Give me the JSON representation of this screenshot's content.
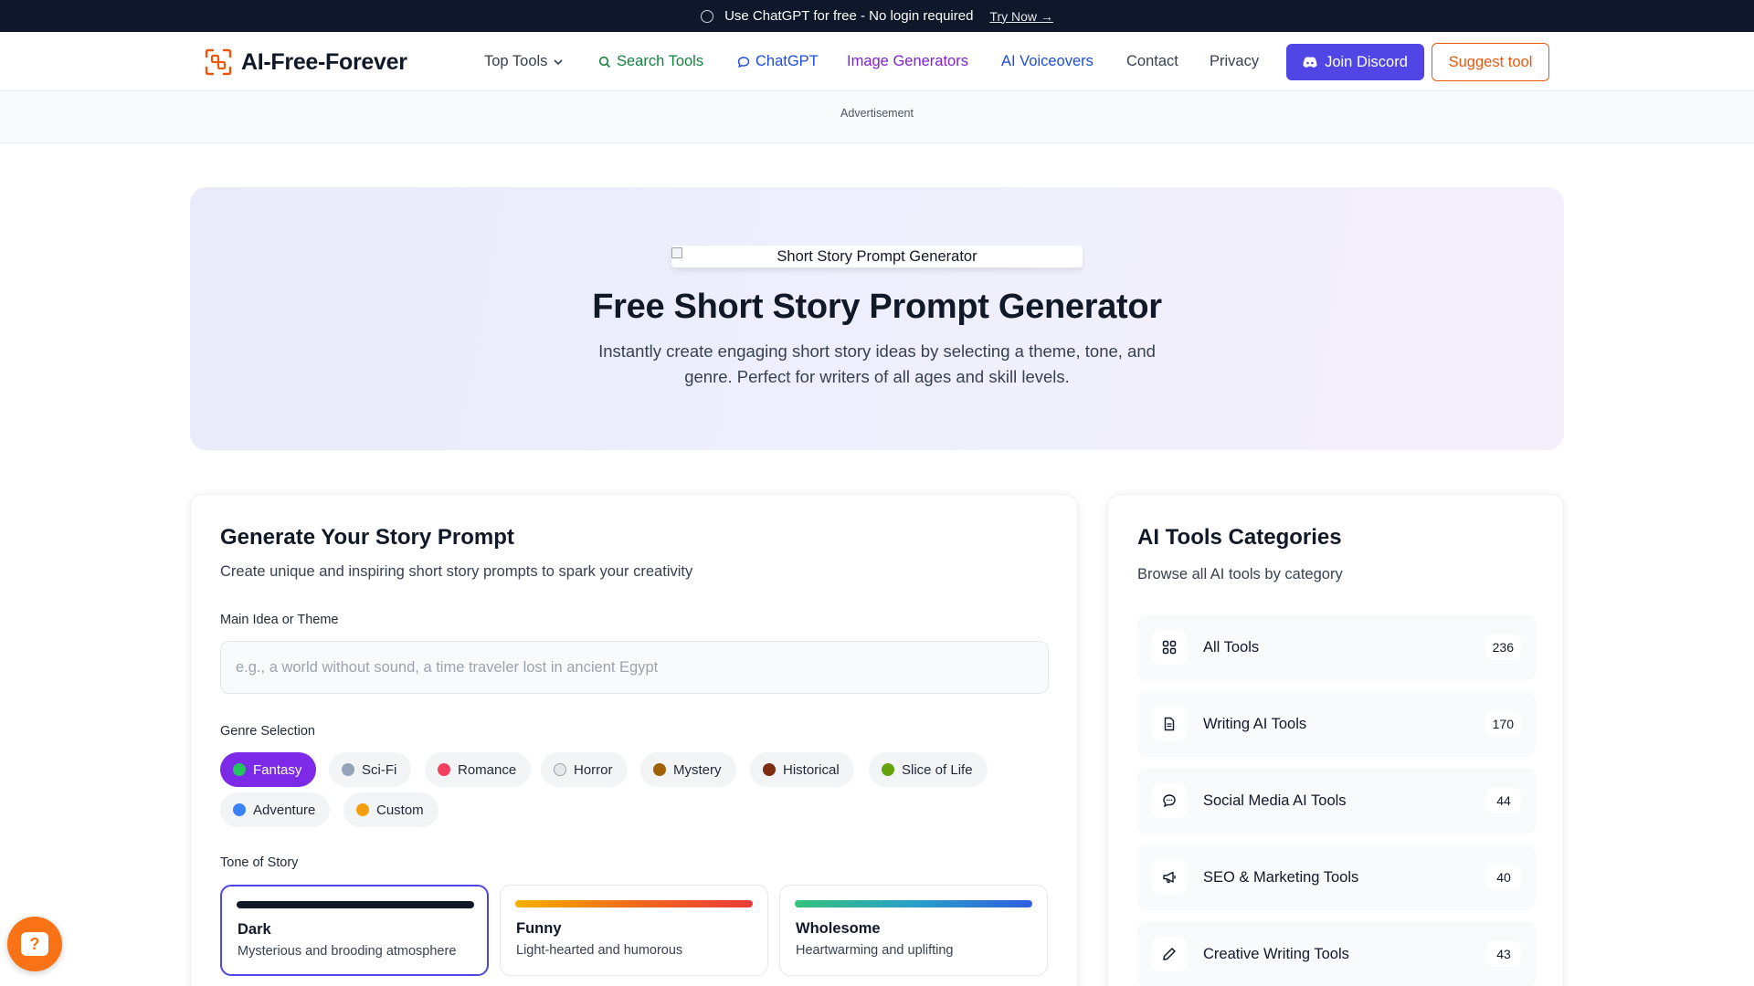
{
  "banner": {
    "text": "Use ChatGPT for free - No login required",
    "link": "Try Now →"
  },
  "nav": {
    "logo": "AI-Free-Forever",
    "links": [
      {
        "label": "Top Tools",
        "color": "#374151"
      },
      {
        "label": "Search Tools",
        "color": "#15803d"
      },
      {
        "label": "ChatGPT",
        "color": "#1d4ed8"
      },
      {
        "label": "Image Generators",
        "color": "#7e22ce"
      },
      {
        "label": "AI Voiceovers",
        "color": "#1d4ed8"
      },
      {
        "label": "Contact",
        "color": "#374151"
      },
      {
        "label": "Privacy",
        "color": "#374151"
      }
    ],
    "discord": "Join Discord",
    "suggest": "Suggest tool"
  },
  "ad": {
    "label": "Advertisement"
  },
  "hero": {
    "image_alt": "Short Story Prompt Generator",
    "title": "Free Short Story Prompt Generator",
    "subtitle": "Instantly create engaging short story ideas by selecting a theme, tone, and genre. Perfect for writers of all ages and skill levels."
  },
  "generator": {
    "title": "Generate Your Story Prompt",
    "subtitle": "Create unique and inspiring short story prompts to spark your creativity",
    "theme_label": "Main Idea or Theme",
    "theme_placeholder": "e.g., a world without sound, a time traveler lost in ancient Egypt",
    "theme_value": "",
    "genre_label": "Genre Selection",
    "genres": [
      {
        "label": "Fantasy",
        "icon": "dragon-icon",
        "active": true
      },
      {
        "label": "Sci-Fi",
        "icon": "rocket-icon",
        "active": false
      },
      {
        "label": "Romance",
        "icon": "heart-icon",
        "active": false
      },
      {
        "label": "Horror",
        "icon": "ghost-icon",
        "active": false
      },
      {
        "label": "Mystery",
        "icon": "detective-icon",
        "active": false
      },
      {
        "label": "Historical",
        "icon": "amphora-icon",
        "active": false
      },
      {
        "label": "Slice of Life",
        "icon": "cake-icon",
        "active": false
      },
      {
        "label": "Adventure",
        "icon": "globe-icon",
        "active": false
      },
      {
        "label": "Custom",
        "icon": "pencil-icon",
        "active": false
      }
    ],
    "tone_label": "Tone of Story",
    "tones": [
      {
        "name": "Dark",
        "desc": "Mysterious and brooding atmosphere",
        "active": true,
        "gradient": "#111827,#111827"
      },
      {
        "name": "Funny",
        "desc": "Light-hearted and humorous",
        "active": false,
        "gradient": "#f5b000,#f26a1b,#ea3a3a"
      },
      {
        "name": "Wholesome",
        "desc": "Heartwarming and uplifting",
        "active": false,
        "gradient": "#34c27a,#2aa0c8,#2f5fe0"
      }
    ]
  },
  "sidebar": {
    "title": "AI Tools Categories",
    "subtitle": "Browse all AI tools by category",
    "categories": [
      {
        "name": "All Tools",
        "count": "236",
        "icon": "grid-icon"
      },
      {
        "name": "Writing AI Tools",
        "count": "170",
        "icon": "document-icon"
      },
      {
        "name": "Social Media AI Tools",
        "count": "44",
        "icon": "chat-bubble-icon"
      },
      {
        "name": "SEO & Marketing Tools",
        "count": "40",
        "icon": "megaphone-icon"
      },
      {
        "name": "Creative Writing Tools",
        "count": "43",
        "icon": "pen-icon"
      }
    ]
  },
  "help": {
    "label": "?"
  }
}
